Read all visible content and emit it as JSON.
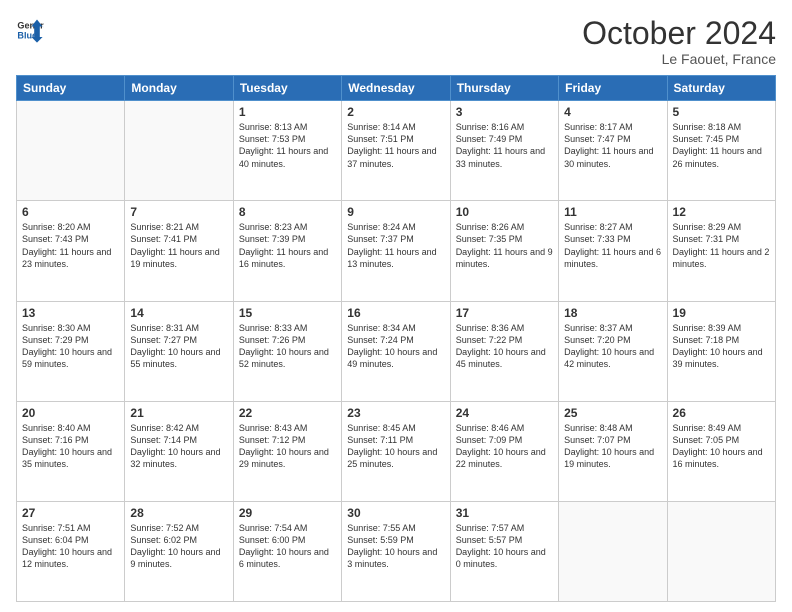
{
  "header": {
    "logo_general": "General",
    "logo_blue": "Blue",
    "month": "October 2024",
    "location": "Le Faouet, France"
  },
  "weekdays": [
    "Sunday",
    "Monday",
    "Tuesday",
    "Wednesday",
    "Thursday",
    "Friday",
    "Saturday"
  ],
  "weeks": [
    [
      {
        "day": "",
        "sunrise": "",
        "sunset": "",
        "daylight": ""
      },
      {
        "day": "",
        "sunrise": "",
        "sunset": "",
        "daylight": ""
      },
      {
        "day": "1",
        "sunrise": "Sunrise: 8:13 AM",
        "sunset": "Sunset: 7:53 PM",
        "daylight": "Daylight: 11 hours and 40 minutes."
      },
      {
        "day": "2",
        "sunrise": "Sunrise: 8:14 AM",
        "sunset": "Sunset: 7:51 PM",
        "daylight": "Daylight: 11 hours and 37 minutes."
      },
      {
        "day": "3",
        "sunrise": "Sunrise: 8:16 AM",
        "sunset": "Sunset: 7:49 PM",
        "daylight": "Daylight: 11 hours and 33 minutes."
      },
      {
        "day": "4",
        "sunrise": "Sunrise: 8:17 AM",
        "sunset": "Sunset: 7:47 PM",
        "daylight": "Daylight: 11 hours and 30 minutes."
      },
      {
        "day": "5",
        "sunrise": "Sunrise: 8:18 AM",
        "sunset": "Sunset: 7:45 PM",
        "daylight": "Daylight: 11 hours and 26 minutes."
      }
    ],
    [
      {
        "day": "6",
        "sunrise": "Sunrise: 8:20 AM",
        "sunset": "Sunset: 7:43 PM",
        "daylight": "Daylight: 11 hours and 23 minutes."
      },
      {
        "day": "7",
        "sunrise": "Sunrise: 8:21 AM",
        "sunset": "Sunset: 7:41 PM",
        "daylight": "Daylight: 11 hours and 19 minutes."
      },
      {
        "day": "8",
        "sunrise": "Sunrise: 8:23 AM",
        "sunset": "Sunset: 7:39 PM",
        "daylight": "Daylight: 11 hours and 16 minutes."
      },
      {
        "day": "9",
        "sunrise": "Sunrise: 8:24 AM",
        "sunset": "Sunset: 7:37 PM",
        "daylight": "Daylight: 11 hours and 13 minutes."
      },
      {
        "day": "10",
        "sunrise": "Sunrise: 8:26 AM",
        "sunset": "Sunset: 7:35 PM",
        "daylight": "Daylight: 11 hours and 9 minutes."
      },
      {
        "day": "11",
        "sunrise": "Sunrise: 8:27 AM",
        "sunset": "Sunset: 7:33 PM",
        "daylight": "Daylight: 11 hours and 6 minutes."
      },
      {
        "day": "12",
        "sunrise": "Sunrise: 8:29 AM",
        "sunset": "Sunset: 7:31 PM",
        "daylight": "Daylight: 11 hours and 2 minutes."
      }
    ],
    [
      {
        "day": "13",
        "sunrise": "Sunrise: 8:30 AM",
        "sunset": "Sunset: 7:29 PM",
        "daylight": "Daylight: 10 hours and 59 minutes."
      },
      {
        "day": "14",
        "sunrise": "Sunrise: 8:31 AM",
        "sunset": "Sunset: 7:27 PM",
        "daylight": "Daylight: 10 hours and 55 minutes."
      },
      {
        "day": "15",
        "sunrise": "Sunrise: 8:33 AM",
        "sunset": "Sunset: 7:26 PM",
        "daylight": "Daylight: 10 hours and 52 minutes."
      },
      {
        "day": "16",
        "sunrise": "Sunrise: 8:34 AM",
        "sunset": "Sunset: 7:24 PM",
        "daylight": "Daylight: 10 hours and 49 minutes."
      },
      {
        "day": "17",
        "sunrise": "Sunrise: 8:36 AM",
        "sunset": "Sunset: 7:22 PM",
        "daylight": "Daylight: 10 hours and 45 minutes."
      },
      {
        "day": "18",
        "sunrise": "Sunrise: 8:37 AM",
        "sunset": "Sunset: 7:20 PM",
        "daylight": "Daylight: 10 hours and 42 minutes."
      },
      {
        "day": "19",
        "sunrise": "Sunrise: 8:39 AM",
        "sunset": "Sunset: 7:18 PM",
        "daylight": "Daylight: 10 hours and 39 minutes."
      }
    ],
    [
      {
        "day": "20",
        "sunrise": "Sunrise: 8:40 AM",
        "sunset": "Sunset: 7:16 PM",
        "daylight": "Daylight: 10 hours and 35 minutes."
      },
      {
        "day": "21",
        "sunrise": "Sunrise: 8:42 AM",
        "sunset": "Sunset: 7:14 PM",
        "daylight": "Daylight: 10 hours and 32 minutes."
      },
      {
        "day": "22",
        "sunrise": "Sunrise: 8:43 AM",
        "sunset": "Sunset: 7:12 PM",
        "daylight": "Daylight: 10 hours and 29 minutes."
      },
      {
        "day": "23",
        "sunrise": "Sunrise: 8:45 AM",
        "sunset": "Sunset: 7:11 PM",
        "daylight": "Daylight: 10 hours and 25 minutes."
      },
      {
        "day": "24",
        "sunrise": "Sunrise: 8:46 AM",
        "sunset": "Sunset: 7:09 PM",
        "daylight": "Daylight: 10 hours and 22 minutes."
      },
      {
        "day": "25",
        "sunrise": "Sunrise: 8:48 AM",
        "sunset": "Sunset: 7:07 PM",
        "daylight": "Daylight: 10 hours and 19 minutes."
      },
      {
        "day": "26",
        "sunrise": "Sunrise: 8:49 AM",
        "sunset": "Sunset: 7:05 PM",
        "daylight": "Daylight: 10 hours and 16 minutes."
      }
    ],
    [
      {
        "day": "27",
        "sunrise": "Sunrise: 7:51 AM",
        "sunset": "Sunset: 6:04 PM",
        "daylight": "Daylight: 10 hours and 12 minutes."
      },
      {
        "day": "28",
        "sunrise": "Sunrise: 7:52 AM",
        "sunset": "Sunset: 6:02 PM",
        "daylight": "Daylight: 10 hours and 9 minutes."
      },
      {
        "day": "29",
        "sunrise": "Sunrise: 7:54 AM",
        "sunset": "Sunset: 6:00 PM",
        "daylight": "Daylight: 10 hours and 6 minutes."
      },
      {
        "day": "30",
        "sunrise": "Sunrise: 7:55 AM",
        "sunset": "Sunset: 5:59 PM",
        "daylight": "Daylight: 10 hours and 3 minutes."
      },
      {
        "day": "31",
        "sunrise": "Sunrise: 7:57 AM",
        "sunset": "Sunset: 5:57 PM",
        "daylight": "Daylight: 10 hours and 0 minutes."
      },
      {
        "day": "",
        "sunrise": "",
        "sunset": "",
        "daylight": ""
      },
      {
        "day": "",
        "sunrise": "",
        "sunset": "",
        "daylight": ""
      }
    ]
  ]
}
